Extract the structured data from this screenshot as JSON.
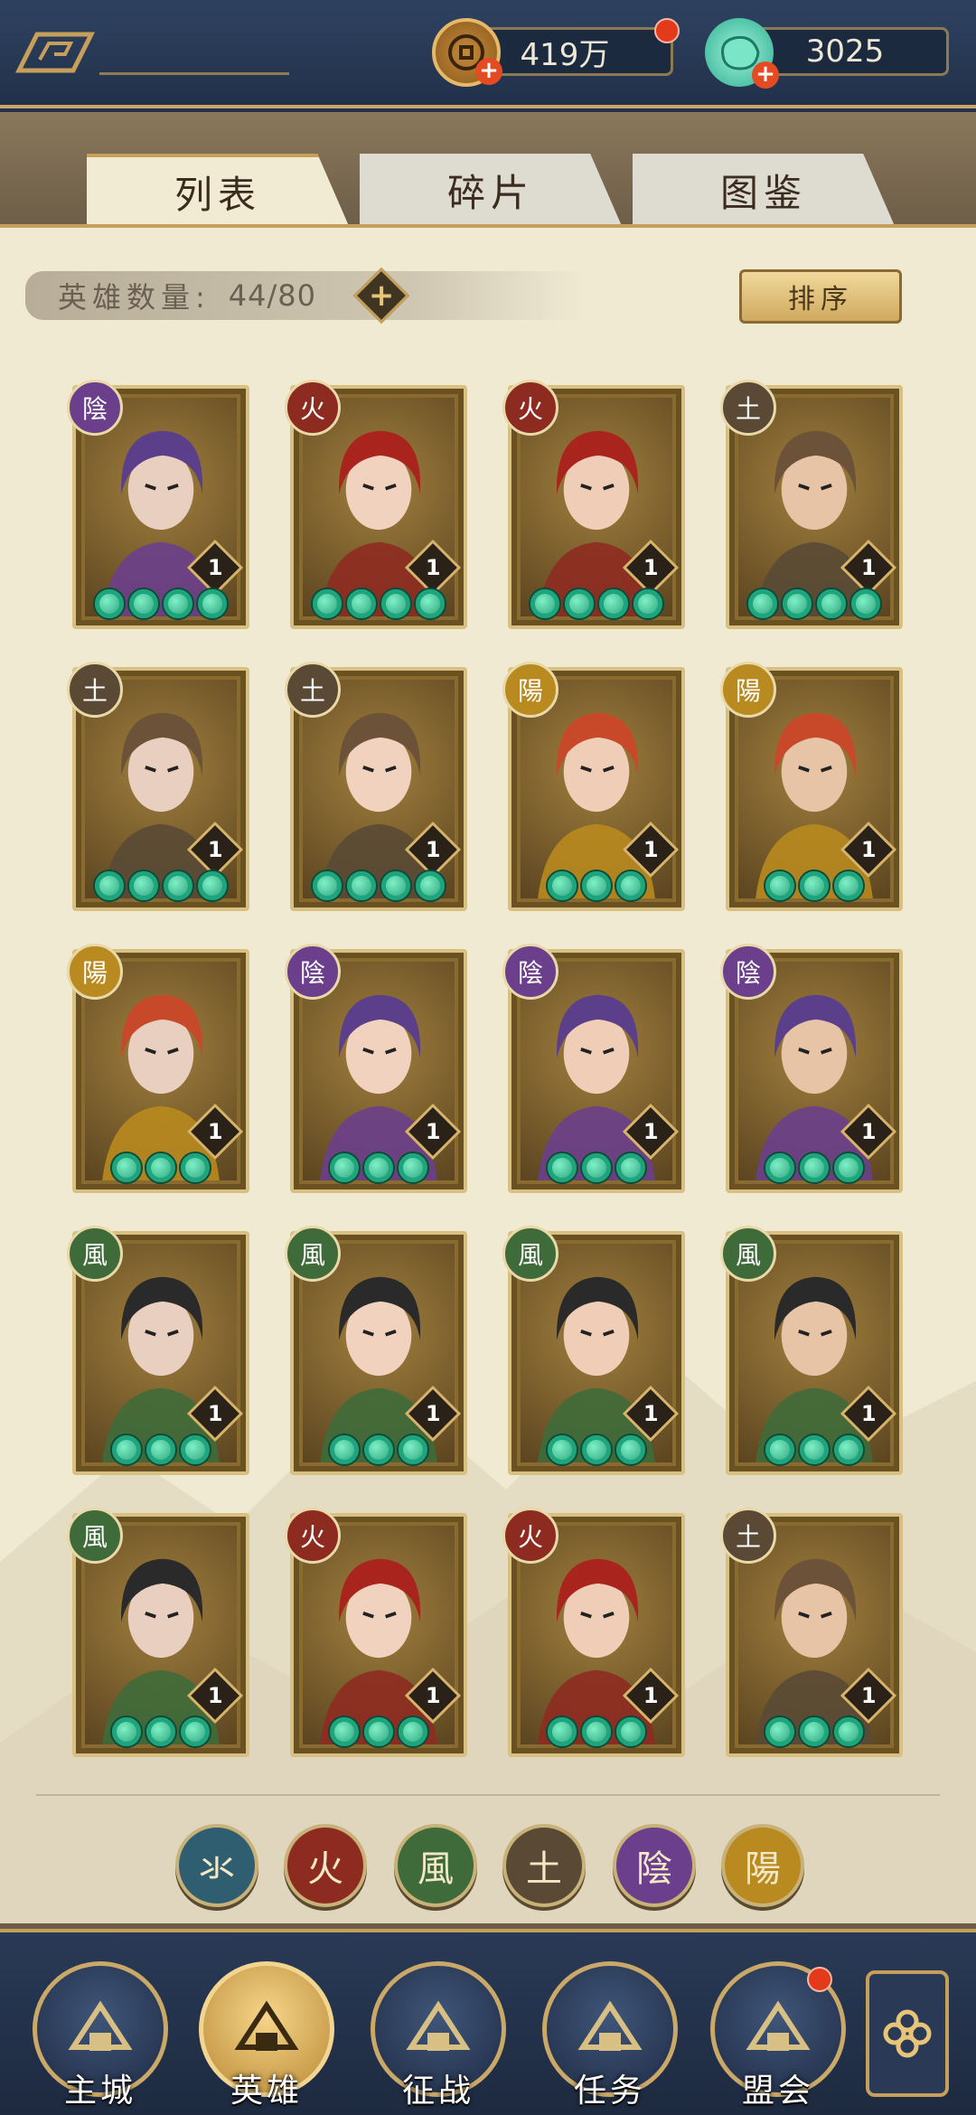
{
  "top": {
    "currencies": [
      {
        "name": "copper-coin",
        "value": "419万"
      },
      {
        "name": "jade",
        "value": "3025"
      }
    ]
  },
  "tabs": [
    {
      "label": "列表",
      "active": true
    },
    {
      "label": "碎片",
      "active": false
    },
    {
      "label": "图鉴",
      "active": false
    }
  ],
  "hero_count": {
    "label": "英雄数量:",
    "value": "44/80"
  },
  "sort_label": "排序",
  "element_colors": {
    "阴": "#6b3f8c",
    "火": "#8e2b21",
    "土": "#5a4a35",
    "阳": "#b98a1f",
    "风": "#3f6b3a",
    "水": "#2e5e6f"
  },
  "heroes": [
    {
      "element": "陰",
      "key": "阴",
      "level": "1",
      "stars": 4
    },
    {
      "element": "火",
      "key": "火",
      "level": "1",
      "stars": 4
    },
    {
      "element": "火",
      "key": "火",
      "level": "1",
      "stars": 4
    },
    {
      "element": "土",
      "key": "土",
      "level": "1",
      "stars": 4
    },
    {
      "element": "土",
      "key": "土",
      "level": "1",
      "stars": 4
    },
    {
      "element": "土",
      "key": "土",
      "level": "1",
      "stars": 4
    },
    {
      "element": "陽",
      "key": "阳",
      "level": "1",
      "stars": 3
    },
    {
      "element": "陽",
      "key": "阳",
      "level": "1",
      "stars": 3
    },
    {
      "element": "陽",
      "key": "阳",
      "level": "1",
      "stars": 3
    },
    {
      "element": "陰",
      "key": "阴",
      "level": "1",
      "stars": 3
    },
    {
      "element": "陰",
      "key": "阴",
      "level": "1",
      "stars": 3
    },
    {
      "element": "陰",
      "key": "阴",
      "level": "1",
      "stars": 3
    },
    {
      "element": "風",
      "key": "风",
      "level": "1",
      "stars": 3
    },
    {
      "element": "風",
      "key": "风",
      "level": "1",
      "stars": 3
    },
    {
      "element": "風",
      "key": "风",
      "level": "1",
      "stars": 3
    },
    {
      "element": "風",
      "key": "风",
      "level": "1",
      "stars": 3
    },
    {
      "element": "風",
      "key": "风",
      "level": "1",
      "stars": 3
    },
    {
      "element": "火",
      "key": "火",
      "level": "1",
      "stars": 3
    },
    {
      "element": "火",
      "key": "火",
      "level": "1",
      "stars": 3
    },
    {
      "element": "土",
      "key": "土",
      "level": "1",
      "stars": 3
    }
  ],
  "filters": [
    {
      "glyph": "氺",
      "key": "水"
    },
    {
      "glyph": "火",
      "key": "火"
    },
    {
      "glyph": "風",
      "key": "风"
    },
    {
      "glyph": "土",
      "key": "土"
    },
    {
      "glyph": "陰",
      "key": "阴"
    },
    {
      "glyph": "陽",
      "key": "阳"
    }
  ],
  "nav": [
    {
      "label": "主城",
      "icon": "city-gate-icon",
      "active": false
    },
    {
      "label": "英雄",
      "icon": "hero-icon",
      "active": true
    },
    {
      "label": "征战",
      "icon": "battle-icon",
      "active": false
    },
    {
      "label": "任务",
      "icon": "task-scroll-icon",
      "active": false
    },
    {
      "label": "盟会",
      "icon": "alliance-icon",
      "active": false
    }
  ]
}
